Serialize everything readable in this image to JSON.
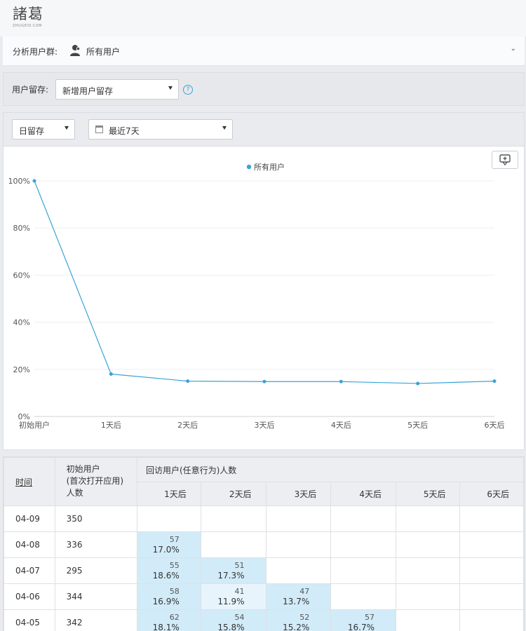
{
  "brand": {
    "logo_text": "諸葛",
    "logo_sub": "ZHUGEIO.COM"
  },
  "user_group": {
    "label": "分析用户群:",
    "value": "所有用户",
    "icon": "user-group-icon"
  },
  "retention": {
    "label": "用户留存:",
    "select_value": "新增用户留存",
    "help_icon": "question-icon"
  },
  "chart_controls": {
    "period_select": "日留存",
    "range_select": "最近7天"
  },
  "chart_data": {
    "type": "line",
    "legend": [
      "所有用户"
    ],
    "legend_position": "top-center",
    "categories": [
      "初始用户",
      "1天后",
      "2天后",
      "3天后",
      "4天后",
      "5天后",
      "6天后"
    ],
    "y_ticks": [
      "0%",
      "20%",
      "40%",
      "60%",
      "80%",
      "100%"
    ],
    "ylim": [
      0,
      100
    ],
    "grid": true,
    "color": "#3aa3d8",
    "series": [
      {
        "name": "所有用户",
        "values": [
          100,
          18,
          15,
          14.8,
          14.8,
          14,
          15
        ]
      }
    ]
  },
  "table": {
    "col_time": "时间",
    "col_initial": [
      "初始用户",
      "(首次打开应用)",
      "人数"
    ],
    "col_return": "回访用户(任意行为)人数",
    "days": [
      "1天后",
      "2天后",
      "3天后",
      "4天后",
      "5天后",
      "6天后"
    ],
    "rows": [
      {
        "date": "04-09",
        "count": "350",
        "cells": []
      },
      {
        "date": "04-08",
        "count": "336",
        "cells": [
          {
            "n": "57",
            "p": "17.0%"
          }
        ]
      },
      {
        "date": "04-07",
        "count": "295",
        "cells": [
          {
            "n": "55",
            "p": "18.6%"
          },
          {
            "n": "51",
            "p": "17.3%"
          }
        ]
      },
      {
        "date": "04-06",
        "count": "344",
        "cells": [
          {
            "n": "58",
            "p": "16.9%"
          },
          {
            "n": "41",
            "p": "11.9%"
          },
          {
            "n": "47",
            "p": "13.7%"
          }
        ]
      },
      {
        "date": "04-05",
        "count": "342",
        "cells": [
          {
            "n": "62",
            "p": "18.1%"
          },
          {
            "n": "54",
            "p": "15.8%"
          },
          {
            "n": "52",
            "p": "15.2%"
          },
          {
            "n": "57",
            "p": "16.7%"
          }
        ]
      }
    ]
  }
}
